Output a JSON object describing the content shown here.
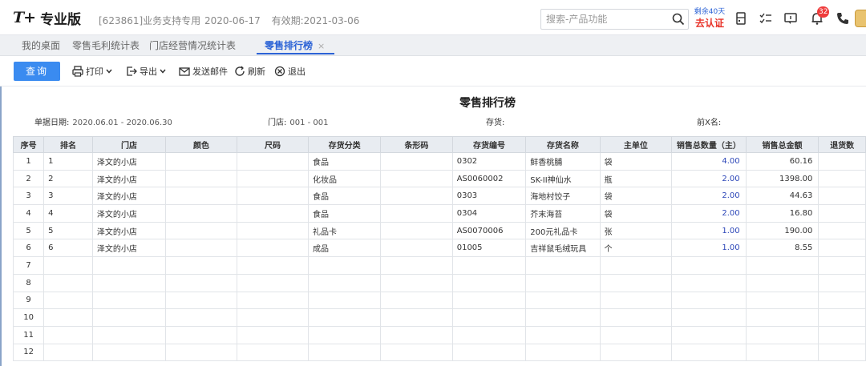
{
  "header": {
    "logo_mark": "T+",
    "product_name": "专业版",
    "company": "[623861]业务支持专用",
    "date": "2020-06-17",
    "validity": "有效期:2021-03-06",
    "search_placeholder": "搜索-产品功能",
    "remaining": "剩余40天",
    "certify": "去认证",
    "notification_count": "32"
  },
  "tabs": [
    {
      "label": "我的桌面"
    },
    {
      "label": "零售毛利统计表"
    },
    {
      "label": "门店经营情况统计表"
    },
    {
      "label": "零售排行榜",
      "close": "×"
    }
  ],
  "toolbar": {
    "query": "查询",
    "print": "打印",
    "export": "导出",
    "send_mail": "发送邮件",
    "refresh": "刷新",
    "exit": "退出"
  },
  "report": {
    "title": "零售排行榜",
    "date_label": "单据日期:",
    "date_value": "2020.06.01 - 2020.06.30",
    "store_label": "门店:",
    "store_value": "001 - 001",
    "stock_label": "存货:",
    "topx_label": "前X名:"
  },
  "columns": [
    "序号",
    "排名",
    "门店",
    "颜色",
    "尺码",
    "存货分类",
    "条形码",
    "存货编号",
    "存货名称",
    "主单位",
    "销售总数量（主）",
    "销售总金额",
    "退货数"
  ],
  "rows": [
    {
      "seq": "1",
      "rank": "1",
      "store": "泽文的小店",
      "color": "",
      "size": "",
      "category": "食品",
      "barcode": "",
      "code": "0302",
      "name": "鲜香桃脯",
      "unit": "袋",
      "qty": "4.00",
      "amount": "60.16",
      "ret": ""
    },
    {
      "seq": "2",
      "rank": "2",
      "store": "泽文的小店",
      "color": "",
      "size": "",
      "category": "化妆品",
      "barcode": "",
      "code": "AS0060002",
      "name": "SK-II神仙水",
      "unit": "瓶",
      "qty": "2.00",
      "amount": "1398.00",
      "ret": ""
    },
    {
      "seq": "3",
      "rank": "3",
      "store": "泽文的小店",
      "color": "",
      "size": "",
      "category": "食品",
      "barcode": "",
      "code": "0303",
      "name": "海地村饺子",
      "unit": "袋",
      "qty": "2.00",
      "amount": "44.63",
      "ret": ""
    },
    {
      "seq": "4",
      "rank": "4",
      "store": "泽文的小店",
      "color": "",
      "size": "",
      "category": "食品",
      "barcode": "",
      "code": "0304",
      "name": "芥末海苔",
      "unit": "袋",
      "qty": "2.00",
      "amount": "16.80",
      "ret": ""
    },
    {
      "seq": "5",
      "rank": "5",
      "store": "泽文的小店",
      "color": "",
      "size": "",
      "category": "礼品卡",
      "barcode": "",
      "code": "AS0070006",
      "name": "200元礼品卡",
      "unit": "张",
      "qty": "1.00",
      "amount": "190.00",
      "ret": ""
    },
    {
      "seq": "6",
      "rank": "6",
      "store": "泽文的小店",
      "color": "",
      "size": "",
      "category": "成品",
      "barcode": "",
      "code": "01005",
      "name": "吉祥鼠毛绒玩具",
      "unit": "个",
      "qty": "1.00",
      "amount": "8.55",
      "ret": ""
    },
    {
      "seq": "7",
      "rank": "",
      "store": "",
      "color": "",
      "size": "",
      "category": "",
      "barcode": "",
      "code": "",
      "name": "",
      "unit": "",
      "qty": "",
      "amount": "",
      "ret": ""
    },
    {
      "seq": "8",
      "rank": "",
      "store": "",
      "color": "",
      "size": "",
      "category": "",
      "barcode": "",
      "code": "",
      "name": "",
      "unit": "",
      "qty": "",
      "amount": "",
      "ret": ""
    },
    {
      "seq": "9",
      "rank": "",
      "store": "",
      "color": "",
      "size": "",
      "category": "",
      "barcode": "",
      "code": "",
      "name": "",
      "unit": "",
      "qty": "",
      "amount": "",
      "ret": ""
    },
    {
      "seq": "10",
      "rank": "",
      "store": "",
      "color": "",
      "size": "",
      "category": "",
      "barcode": "",
      "code": "",
      "name": "",
      "unit": "",
      "qty": "",
      "amount": "",
      "ret": ""
    },
    {
      "seq": "11",
      "rank": "",
      "store": "",
      "color": "",
      "size": "",
      "category": "",
      "barcode": "",
      "code": "",
      "name": "",
      "unit": "",
      "qty": "",
      "amount": "",
      "ret": ""
    },
    {
      "seq": "12",
      "rank": "",
      "store": "",
      "color": "",
      "size": "",
      "category": "",
      "barcode": "",
      "code": "",
      "name": "",
      "unit": "",
      "qty": "",
      "amount": "",
      "ret": ""
    }
  ],
  "icons": {
    "search": "search-icon",
    "calculator": "calculator-icon",
    "checklist": "checklist-icon",
    "message": "message-icon",
    "bell": "bell-icon",
    "phone": "phone-icon",
    "printer": "printer-icon",
    "export": "export-icon",
    "mail": "mail-icon",
    "refresh": "refresh-icon",
    "exit": "exit-icon"
  },
  "colors": {
    "accent": "#3a8bf0",
    "active_tab": "#2c63d6",
    "certify": "#e8342a",
    "badge": "#ef3b3b",
    "qty_text": "#2c46b8"
  }
}
